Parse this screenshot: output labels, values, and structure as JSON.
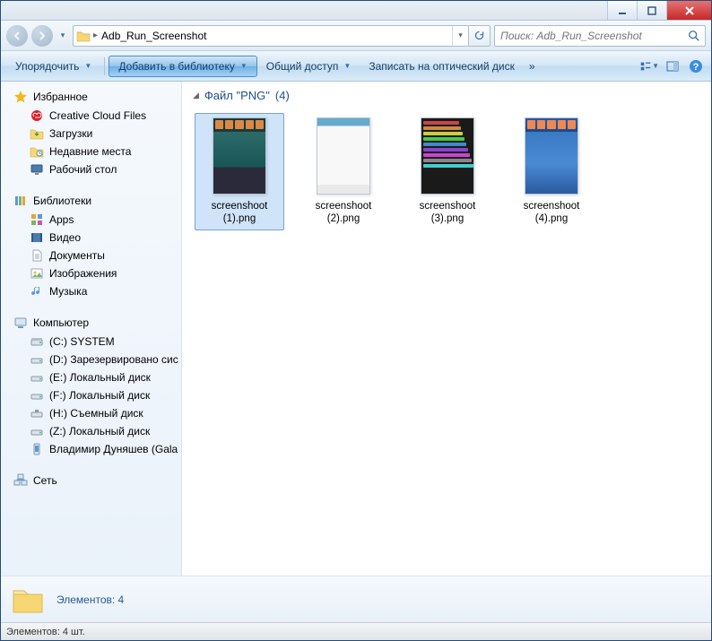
{
  "address": {
    "path": "Adb_Run_Screenshot",
    "separator": "▸"
  },
  "search": {
    "placeholder": "Поиск: Adb_Run_Screenshot"
  },
  "toolbar": {
    "organize": "Упорядочить",
    "include": "Добавить в библиотеку",
    "share": "Общий доступ",
    "burn": "Записать на оптический диск",
    "overflow": "»"
  },
  "sidebar": {
    "favorites": {
      "label": "Избранное",
      "items": [
        {
          "icon": "creative-cloud",
          "label": "Creative Cloud Files"
        },
        {
          "icon": "downloads",
          "label": "Загрузки"
        },
        {
          "icon": "recent",
          "label": "Недавние места"
        },
        {
          "icon": "desktop",
          "label": "Рабочий стол"
        }
      ]
    },
    "libraries": {
      "label": "Библиотеки",
      "items": [
        {
          "icon": "apps",
          "label": "Apps"
        },
        {
          "icon": "video",
          "label": "Видео"
        },
        {
          "icon": "documents",
          "label": "Документы"
        },
        {
          "icon": "pictures",
          "label": "Изображения"
        },
        {
          "icon": "music",
          "label": "Музыка"
        }
      ]
    },
    "computer": {
      "label": "Компьютер",
      "items": [
        {
          "icon": "drive-sys",
          "label": "(C:) SYSTEM"
        },
        {
          "icon": "drive",
          "label": "(D:) Зарезервировано сис"
        },
        {
          "icon": "drive",
          "label": "(E:) Локальный диск"
        },
        {
          "icon": "drive",
          "label": "(F:) Локальный диск"
        },
        {
          "icon": "drive-usb",
          "label": "(H:) Съемный диск"
        },
        {
          "icon": "drive",
          "label": "(Z:) Локальный диск"
        },
        {
          "icon": "phone",
          "label": "Владимир Дуняшев (Gala"
        }
      ]
    },
    "network": {
      "label": "Сеть"
    }
  },
  "contentHeader": {
    "label": "Файл \"PNG\"",
    "count": "(4)"
  },
  "files": [
    {
      "name": "screenshoot (1).png",
      "selected": true,
      "thumb": "dark-teal"
    },
    {
      "name": "screenshoot (2).png",
      "selected": false,
      "thumb": "light"
    },
    {
      "name": "screenshoot (3).png",
      "selected": false,
      "thumb": "black-list"
    },
    {
      "name": "screenshoot (4).png",
      "selected": false,
      "thumb": "blue"
    }
  ],
  "details": {
    "text": "Элементов: 4"
  },
  "status": {
    "text": "Элементов: 4 шт."
  }
}
